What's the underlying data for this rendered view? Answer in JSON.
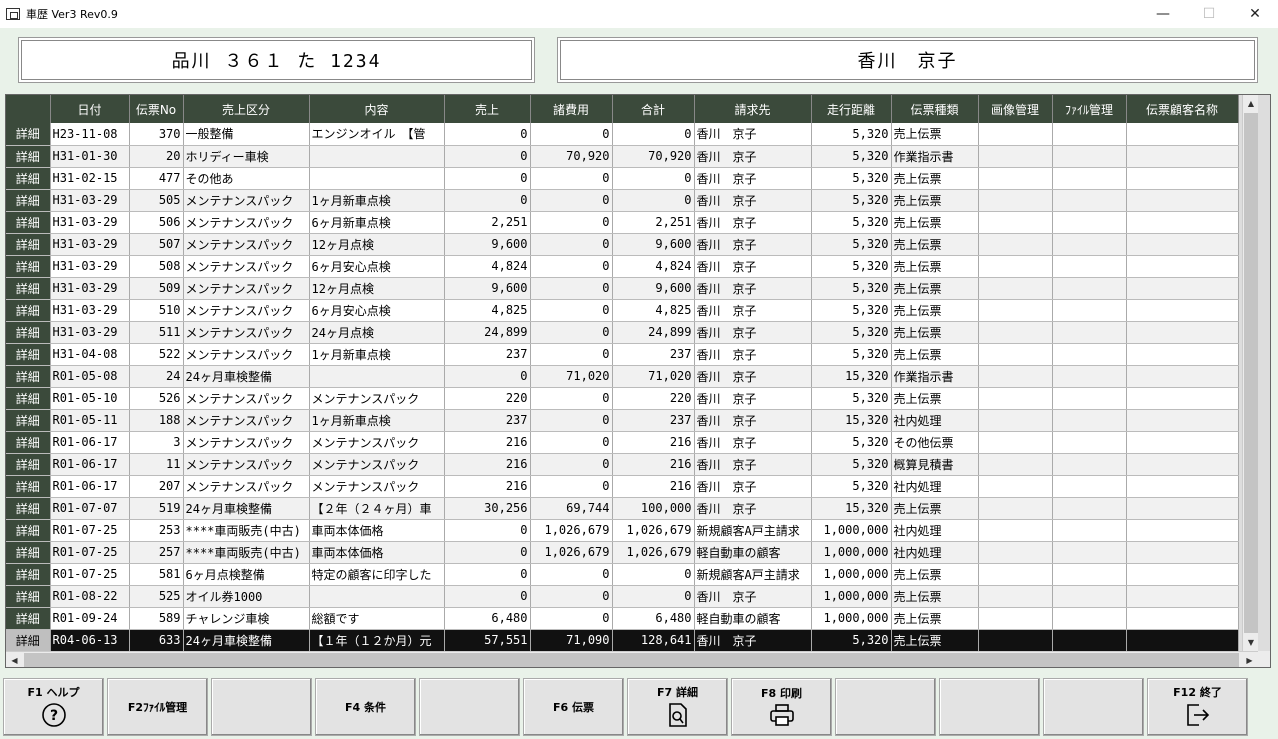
{
  "window": {
    "title": "車歴 Ver3 Rev0.9",
    "minimize": "—",
    "maximize": "☐",
    "close": "✕"
  },
  "vehicle": {
    "plate": "品川 ３６１ た 1234"
  },
  "customer": {
    "name": "香川　京子"
  },
  "table": {
    "columns": [
      "",
      "日付",
      "伝票No",
      "売上区分",
      "内容",
      "売上",
      "諸費用",
      "合計",
      "請求先",
      "走行距離",
      "伝票種類",
      "画像管理",
      "ﾌｧｲﾙ管理",
      "伝票顧客名称"
    ],
    "detail_label": "詳細",
    "selected_row": 23,
    "rows": [
      [
        "H23-11-08",
        "370",
        "一般整備",
        "エンジンオイル　【管",
        "0",
        "0",
        "0",
        "香川　京子",
        "5,320",
        "売上伝票",
        "",
        "",
        ""
      ],
      [
        "H31-01-30",
        "20",
        "ホリディー車検",
        "",
        "0",
        "70,920",
        "70,920",
        "香川　京子",
        "5,320",
        "作業指示書",
        "",
        "",
        ""
      ],
      [
        "H31-02-15",
        "477",
        "その他あ",
        "",
        "0",
        "0",
        "0",
        "香川　京子",
        "5,320",
        "売上伝票",
        "",
        "",
        ""
      ],
      [
        "H31-03-29",
        "505",
        "メンテナンスパック",
        "1ヶ月新車点検",
        "0",
        "0",
        "0",
        "香川　京子",
        "5,320",
        "売上伝票",
        "",
        "",
        ""
      ],
      [
        "H31-03-29",
        "506",
        "メンテナンスパック",
        "6ヶ月新車点検",
        "2,251",
        "0",
        "2,251",
        "香川　京子",
        "5,320",
        "売上伝票",
        "",
        "",
        ""
      ],
      [
        "H31-03-29",
        "507",
        "メンテナンスパック",
        "12ヶ月点検",
        "9,600",
        "0",
        "9,600",
        "香川　京子",
        "5,320",
        "売上伝票",
        "",
        "",
        ""
      ],
      [
        "H31-03-29",
        "508",
        "メンテナンスパック",
        "6ヶ月安心点検",
        "4,824",
        "0",
        "4,824",
        "香川　京子",
        "5,320",
        "売上伝票",
        "",
        "",
        ""
      ],
      [
        "H31-03-29",
        "509",
        "メンテナンスパック",
        "12ヶ月点検",
        "9,600",
        "0",
        "9,600",
        "香川　京子",
        "5,320",
        "売上伝票",
        "",
        "",
        ""
      ],
      [
        "H31-03-29",
        "510",
        "メンテナンスパック",
        "6ヶ月安心点検",
        "4,825",
        "0",
        "4,825",
        "香川　京子",
        "5,320",
        "売上伝票",
        "",
        "",
        ""
      ],
      [
        "H31-03-29",
        "511",
        "メンテナンスパック",
        "24ヶ月点検",
        "24,899",
        "0",
        "24,899",
        "香川　京子",
        "5,320",
        "売上伝票",
        "",
        "",
        ""
      ],
      [
        "H31-04-08",
        "522",
        "メンテナンスパック",
        "1ヶ月新車点検",
        "237",
        "0",
        "237",
        "香川　京子",
        "5,320",
        "売上伝票",
        "",
        "",
        ""
      ],
      [
        "R01-05-08",
        "24",
        "24ヶ月車検整備",
        "",
        "0",
        "71,020",
        "71,020",
        "香川　京子",
        "15,320",
        "作業指示書",
        "",
        "",
        ""
      ],
      [
        "R01-05-10",
        "526",
        "メンテナンスパック",
        "メンテナンスパック",
        "220",
        "0",
        "220",
        "香川　京子",
        "5,320",
        "売上伝票",
        "",
        "",
        ""
      ],
      [
        "R01-05-11",
        "188",
        "メンテナンスパック",
        "1ヶ月新車点検",
        "237",
        "0",
        "237",
        "香川　京子",
        "15,320",
        "社内処理",
        "",
        "",
        ""
      ],
      [
        "R01-06-17",
        "3",
        "メンテナンスパック",
        "メンテナンスパック",
        "216",
        "0",
        "216",
        "香川　京子",
        "5,320",
        "その他伝票",
        "",
        "",
        ""
      ],
      [
        "R01-06-17",
        "11",
        "メンテナンスパック",
        "メンテナンスパック",
        "216",
        "0",
        "216",
        "香川　京子",
        "5,320",
        "概算見積書",
        "",
        "",
        ""
      ],
      [
        "R01-06-17",
        "207",
        "メンテナンスパック",
        "メンテナンスパック",
        "216",
        "0",
        "216",
        "香川　京子",
        "5,320",
        "社内処理",
        "",
        "",
        ""
      ],
      [
        "R01-07-07",
        "519",
        "24ヶ月車検整備",
        "【２年（２４ヶ月）車",
        "30,256",
        "69,744",
        "100,000",
        "香川　京子",
        "15,320",
        "売上伝票",
        "",
        "",
        ""
      ],
      [
        "R01-07-25",
        "253",
        "****車両販売(中古)",
        "車両本体価格",
        "0",
        "1,026,679",
        "1,026,679",
        "新規顧客A戸主請求",
        "1,000,000",
        "社内処理",
        "",
        "",
        ""
      ],
      [
        "R01-07-25",
        "257",
        "****車両販売(中古)",
        "車両本体価格",
        "0",
        "1,026,679",
        "1,026,679",
        "軽自動車の顧客",
        "1,000,000",
        "社内処理",
        "",
        "",
        ""
      ],
      [
        "R01-07-25",
        "581",
        "6ヶ月点検整備",
        "特定の顧客に印字した",
        "0",
        "0",
        "0",
        "新規顧客A戸主請求",
        "1,000,000",
        "売上伝票",
        "",
        "",
        ""
      ],
      [
        "R01-08-22",
        "525",
        "オイル券1000",
        "",
        "0",
        "0",
        "0",
        "香川　京子",
        "1,000,000",
        "売上伝票",
        "",
        "",
        ""
      ],
      [
        "R01-09-24",
        "589",
        "チャレンジ車検",
        "総額です",
        "6,480",
        "0",
        "6,480",
        "軽自動車の顧客",
        "1,000,000",
        "売上伝票",
        "",
        "",
        ""
      ],
      [
        "R04-06-13",
        "633",
        "24ヶ月車検整備",
        "【１年（１２か月）元",
        "57,551",
        "71,090",
        "128,641",
        "香川　京子",
        "5,320",
        "売上伝票",
        "",
        "",
        ""
      ]
    ]
  },
  "fkeys": [
    {
      "label": "F1 ヘルプ",
      "icon": "help-icon"
    },
    {
      "label": "F2ﾌｧｲﾙ管理",
      "icon": ""
    },
    {
      "label": "",
      "icon": ""
    },
    {
      "label": "F4 条件",
      "icon": ""
    },
    {
      "label": "",
      "icon": ""
    },
    {
      "label": "F6 伝票",
      "icon": ""
    },
    {
      "label": "F7 詳細",
      "icon": "document-search-icon"
    },
    {
      "label": "F8 印刷",
      "icon": "printer-icon"
    },
    {
      "label": "",
      "icon": ""
    },
    {
      "label": "",
      "icon": ""
    },
    {
      "label": "",
      "icon": ""
    },
    {
      "label": "F12 終了",
      "icon": "exit-icon"
    }
  ]
}
